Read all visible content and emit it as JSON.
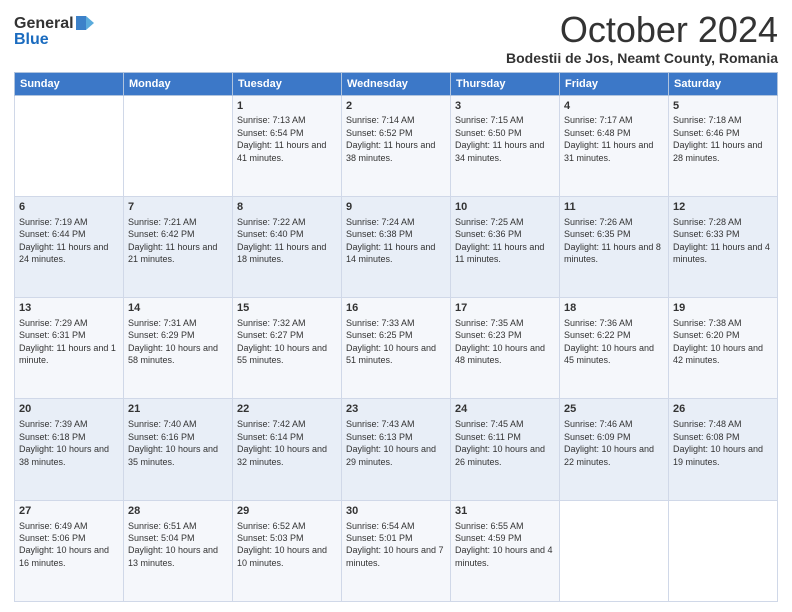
{
  "header": {
    "logo_line1": "General",
    "logo_line2": "Blue",
    "month_title": "October 2024",
    "subtitle": "Bodestii de Jos, Neamt County, Romania"
  },
  "weekdays": [
    "Sunday",
    "Monday",
    "Tuesday",
    "Wednesday",
    "Thursday",
    "Friday",
    "Saturday"
  ],
  "weeks": [
    [
      {
        "day": "",
        "info": ""
      },
      {
        "day": "",
        "info": ""
      },
      {
        "day": "1",
        "info": "Sunrise: 7:13 AM\nSunset: 6:54 PM\nDaylight: 11 hours and 41 minutes."
      },
      {
        "day": "2",
        "info": "Sunrise: 7:14 AM\nSunset: 6:52 PM\nDaylight: 11 hours and 38 minutes."
      },
      {
        "day": "3",
        "info": "Sunrise: 7:15 AM\nSunset: 6:50 PM\nDaylight: 11 hours and 34 minutes."
      },
      {
        "day": "4",
        "info": "Sunrise: 7:17 AM\nSunset: 6:48 PM\nDaylight: 11 hours and 31 minutes."
      },
      {
        "day": "5",
        "info": "Sunrise: 7:18 AM\nSunset: 6:46 PM\nDaylight: 11 hours and 28 minutes."
      }
    ],
    [
      {
        "day": "6",
        "info": "Sunrise: 7:19 AM\nSunset: 6:44 PM\nDaylight: 11 hours and 24 minutes."
      },
      {
        "day": "7",
        "info": "Sunrise: 7:21 AM\nSunset: 6:42 PM\nDaylight: 11 hours and 21 minutes."
      },
      {
        "day": "8",
        "info": "Sunrise: 7:22 AM\nSunset: 6:40 PM\nDaylight: 11 hours and 18 minutes."
      },
      {
        "day": "9",
        "info": "Sunrise: 7:24 AM\nSunset: 6:38 PM\nDaylight: 11 hours and 14 minutes."
      },
      {
        "day": "10",
        "info": "Sunrise: 7:25 AM\nSunset: 6:36 PM\nDaylight: 11 hours and 11 minutes."
      },
      {
        "day": "11",
        "info": "Sunrise: 7:26 AM\nSunset: 6:35 PM\nDaylight: 11 hours and 8 minutes."
      },
      {
        "day": "12",
        "info": "Sunrise: 7:28 AM\nSunset: 6:33 PM\nDaylight: 11 hours and 4 minutes."
      }
    ],
    [
      {
        "day": "13",
        "info": "Sunrise: 7:29 AM\nSunset: 6:31 PM\nDaylight: 11 hours and 1 minute."
      },
      {
        "day": "14",
        "info": "Sunrise: 7:31 AM\nSunset: 6:29 PM\nDaylight: 10 hours and 58 minutes."
      },
      {
        "day": "15",
        "info": "Sunrise: 7:32 AM\nSunset: 6:27 PM\nDaylight: 10 hours and 55 minutes."
      },
      {
        "day": "16",
        "info": "Sunrise: 7:33 AM\nSunset: 6:25 PM\nDaylight: 10 hours and 51 minutes."
      },
      {
        "day": "17",
        "info": "Sunrise: 7:35 AM\nSunset: 6:23 PM\nDaylight: 10 hours and 48 minutes."
      },
      {
        "day": "18",
        "info": "Sunrise: 7:36 AM\nSunset: 6:22 PM\nDaylight: 10 hours and 45 minutes."
      },
      {
        "day": "19",
        "info": "Sunrise: 7:38 AM\nSunset: 6:20 PM\nDaylight: 10 hours and 42 minutes."
      }
    ],
    [
      {
        "day": "20",
        "info": "Sunrise: 7:39 AM\nSunset: 6:18 PM\nDaylight: 10 hours and 38 minutes."
      },
      {
        "day": "21",
        "info": "Sunrise: 7:40 AM\nSunset: 6:16 PM\nDaylight: 10 hours and 35 minutes."
      },
      {
        "day": "22",
        "info": "Sunrise: 7:42 AM\nSunset: 6:14 PM\nDaylight: 10 hours and 32 minutes."
      },
      {
        "day": "23",
        "info": "Sunrise: 7:43 AM\nSunset: 6:13 PM\nDaylight: 10 hours and 29 minutes."
      },
      {
        "day": "24",
        "info": "Sunrise: 7:45 AM\nSunset: 6:11 PM\nDaylight: 10 hours and 26 minutes."
      },
      {
        "day": "25",
        "info": "Sunrise: 7:46 AM\nSunset: 6:09 PM\nDaylight: 10 hours and 22 minutes."
      },
      {
        "day": "26",
        "info": "Sunrise: 7:48 AM\nSunset: 6:08 PM\nDaylight: 10 hours and 19 minutes."
      }
    ],
    [
      {
        "day": "27",
        "info": "Sunrise: 6:49 AM\nSunset: 5:06 PM\nDaylight: 10 hours and 16 minutes."
      },
      {
        "day": "28",
        "info": "Sunrise: 6:51 AM\nSunset: 5:04 PM\nDaylight: 10 hours and 13 minutes."
      },
      {
        "day": "29",
        "info": "Sunrise: 6:52 AM\nSunset: 5:03 PM\nDaylight: 10 hours and 10 minutes."
      },
      {
        "day": "30",
        "info": "Sunrise: 6:54 AM\nSunset: 5:01 PM\nDaylight: 10 hours and 7 minutes."
      },
      {
        "day": "31",
        "info": "Sunrise: 6:55 AM\nSunset: 4:59 PM\nDaylight: 10 hours and 4 minutes."
      },
      {
        "day": "",
        "info": ""
      },
      {
        "day": "",
        "info": ""
      }
    ]
  ]
}
